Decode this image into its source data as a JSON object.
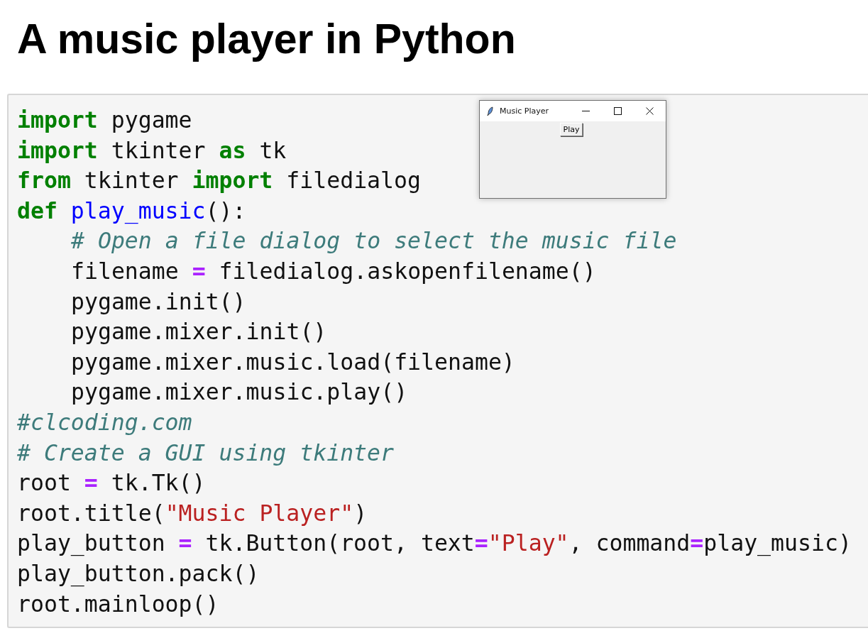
{
  "title": "A music player in Python",
  "code_lines": [
    {
      "tokens": [
        {
          "text": "import",
          "kind": "keyword"
        },
        {
          "text": " pygame",
          "kind": "plain"
        }
      ]
    },
    {
      "tokens": [
        {
          "text": "import",
          "kind": "keyword"
        },
        {
          "text": " tkinter ",
          "kind": "plain"
        },
        {
          "text": "as",
          "kind": "keyword"
        },
        {
          "text": " tk",
          "kind": "plain"
        }
      ]
    },
    {
      "tokens": [
        {
          "text": "from",
          "kind": "keyword"
        },
        {
          "text": " tkinter ",
          "kind": "plain"
        },
        {
          "text": "import",
          "kind": "keyword"
        },
        {
          "text": " filedialog",
          "kind": "plain"
        }
      ]
    },
    {
      "tokens": [
        {
          "text": "def",
          "kind": "keyword"
        },
        {
          "text": " play_music",
          "kind": "function"
        },
        {
          "text": "():",
          "kind": "plain"
        }
      ],
      "children": [
        {
          "tokens": [
            {
              "text": "# Open a file dialog to select the music file",
              "kind": "comment"
            }
          ]
        },
        {
          "tokens": [
            {
              "text": "filename ",
              "kind": "plain"
            },
            {
              "text": "=",
              "kind": "operator"
            },
            {
              "text": " filedialog.askopenfilename()",
              "kind": "plain"
            }
          ]
        },
        {
          "tokens": [
            {
              "text": "pygame.init()",
              "kind": "plain"
            }
          ]
        },
        {
          "tokens": [
            {
              "text": "pygame.mixer.init()",
              "kind": "plain"
            }
          ]
        },
        {
          "tokens": [
            {
              "text": "pygame.mixer.music.load(filename)",
              "kind": "plain"
            }
          ]
        },
        {
          "tokens": [
            {
              "text": "pygame.mixer.music.play()",
              "kind": "plain"
            }
          ]
        }
      ]
    },
    {
      "tokens": [
        {
          "text": "#clcoding.com",
          "kind": "comment"
        }
      ]
    },
    {
      "tokens": [
        {
          "text": "# Create a GUI using tkinter",
          "kind": "comment"
        }
      ]
    },
    {
      "tokens": [
        {
          "text": "root ",
          "kind": "plain"
        },
        {
          "text": "=",
          "kind": "operator"
        },
        {
          "text": " tk.Tk()",
          "kind": "plain"
        }
      ]
    },
    {
      "tokens": [
        {
          "text": "root.title(",
          "kind": "plain"
        },
        {
          "text": "\"Music Player\"",
          "kind": "string"
        },
        {
          "text": ")",
          "kind": "plain"
        }
      ]
    },
    {
      "tokens": [
        {
          "text": "play_button ",
          "kind": "plain"
        },
        {
          "text": "=",
          "kind": "operator"
        },
        {
          "text": " tk.Button(root, text",
          "kind": "plain"
        },
        {
          "text": "=",
          "kind": "operator"
        },
        {
          "text": "\"Play\"",
          "kind": "string"
        },
        {
          "text": ", command",
          "kind": "plain"
        },
        {
          "text": "=",
          "kind": "operator"
        },
        {
          "text": "play_music)",
          "kind": "plain"
        }
      ]
    },
    {
      "tokens": [
        {
          "text": "play_button.pack()",
          "kind": "plain"
        }
      ]
    },
    {
      "tokens": [
        {
          "text": "root.mainloop()",
          "kind": "plain"
        }
      ]
    }
  ],
  "app_window": {
    "title": "Music Player",
    "button": "Play"
  }
}
